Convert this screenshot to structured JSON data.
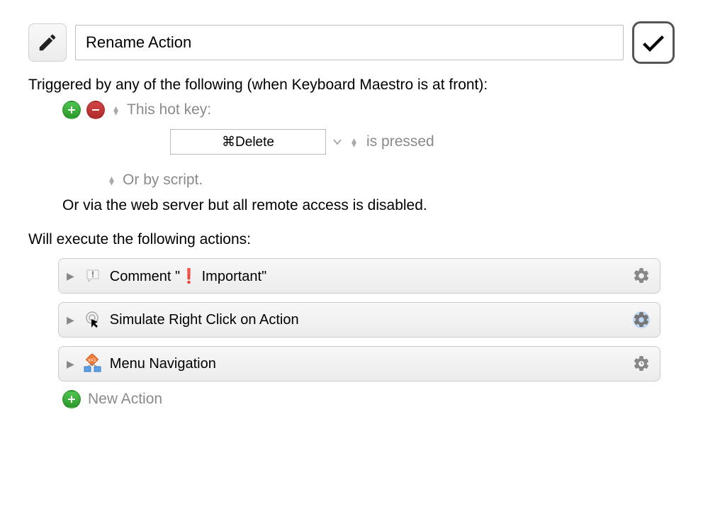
{
  "header": {
    "macro_name": "Rename Action"
  },
  "triggers": {
    "intro_text": "Triggered by any of the following (when Keyboard Maestro is at front):",
    "hotkey_label": "This hot key:",
    "hotkey_value": "⌘Delete",
    "pressed_label": "is pressed",
    "script_label": "Or by script.",
    "webserver_text": "Or via the web server but all remote access is disabled."
  },
  "actions": {
    "header": "Will execute the following actions:",
    "items": [
      {
        "label_prefix": "Comment \"",
        "label_suffix": "  Important\""
      },
      {
        "label": "Simulate Right Click on Action"
      },
      {
        "label": "Menu Navigation"
      }
    ],
    "new_action_label": "New Action"
  }
}
